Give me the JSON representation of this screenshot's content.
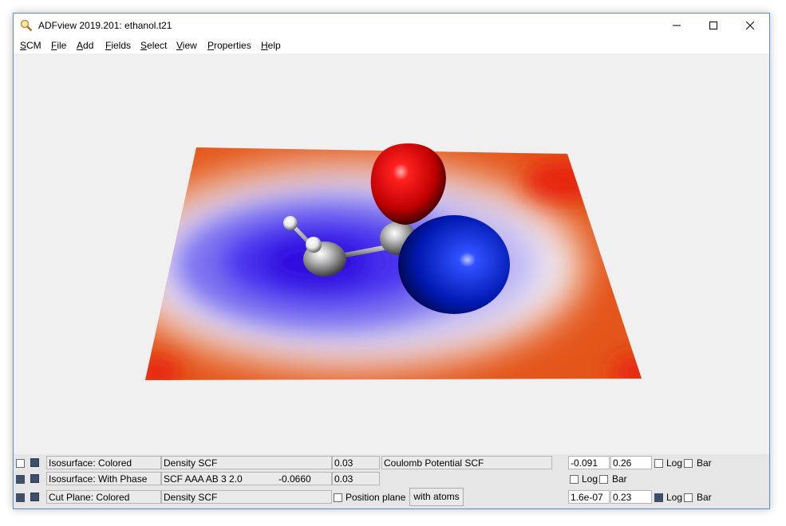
{
  "window": {
    "title": "ADFview 2019.201: ethanol.t21"
  },
  "menu": [
    {
      "label": "SCM"
    },
    {
      "label": "File"
    },
    {
      "label": "Add"
    },
    {
      "label": "Fields"
    },
    {
      "label": "Select"
    },
    {
      "label": "View"
    },
    {
      "label": "Properties"
    },
    {
      "label": "Help"
    }
  ],
  "controls": {
    "row1": {
      "visible": false,
      "type": "Isosurface: Colored",
      "field": "Density SCF",
      "isovalue": "0.03",
      "color_field": "Coulomb Potential SCF",
      "min": "-0.091",
      "max": "0.26",
      "log_label": "Log",
      "bar_label": "Bar",
      "log_checked": false,
      "bar_checked": false
    },
    "row2": {
      "visible": true,
      "type": "Isosurface: With Phase",
      "field": "SCF AAA AB 3 2.0",
      "field_value": "-0.0660",
      "isovalue": "0.03",
      "log_label": "Log",
      "bar_label": "Bar",
      "log_checked": false,
      "bar_checked": false
    },
    "row3": {
      "visible": true,
      "type": "Cut Plane: Colored",
      "field": "Density SCF",
      "position_label": "Position plane",
      "position_checked": false,
      "with_atoms_label": "with atoms",
      "min": "1.6e-07",
      "max": "0.23",
      "log_label": "Log",
      "bar_label": "Bar",
      "log_checked": true,
      "bar_checked": false
    }
  },
  "colors": {
    "window_border": "#5a8fc8",
    "viewport_bg": "#f0f0f0",
    "positive_phase": "#e01010",
    "negative_phase": "#1020d0",
    "plane_high": "#e8200a",
    "plane_low": "#5030f0"
  }
}
